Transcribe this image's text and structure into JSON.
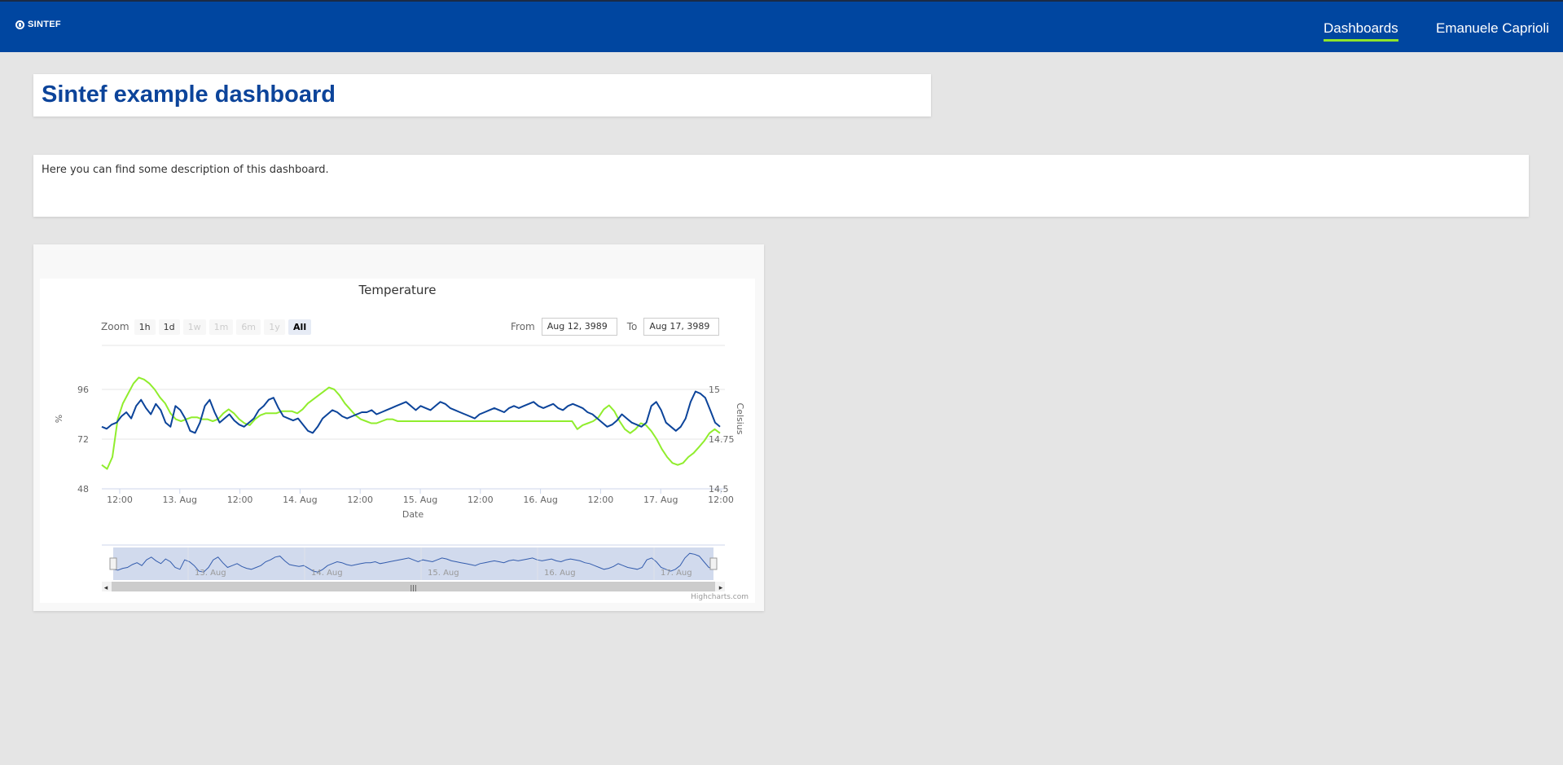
{
  "header": {
    "logo_text": "SINTEF",
    "nav_dashboards": "Dashboards",
    "nav_user": "Emanuele Caprioli"
  },
  "dashboard": {
    "title": "Sintef example dashboard",
    "description": "Here you can find some description of this dashboard."
  },
  "colors": {
    "accent": "#8ee32a",
    "brand": "#0046a0",
    "series_humidity": "#0c449a",
    "series_temperature": "#90ed2d"
  },
  "chart": {
    "zoom_label": "Zoom",
    "zoom_buttons": [
      {
        "label": "1h",
        "state": "normal"
      },
      {
        "label": "1d",
        "state": "normal"
      },
      {
        "label": "1w",
        "state": "disabled"
      },
      {
        "label": "1m",
        "state": "disabled"
      },
      {
        "label": "6m",
        "state": "disabled"
      },
      {
        "label": "1y",
        "state": "disabled"
      },
      {
        "label": "All",
        "state": "active"
      }
    ],
    "from_label": "From",
    "from_value": "Aug 12, 3989",
    "to_label": "To",
    "to_value": "Aug 17, 3989",
    "credits": "Highcharts.com"
  },
  "chart_data": {
    "type": "line",
    "title": "Temperature",
    "xlabel": "Date",
    "x_tick_labels": [
      "12:00",
      "13. Aug",
      "12:00",
      "14. Aug",
      "12:00",
      "15. Aug",
      "12:00",
      "16. Aug",
      "12:00",
      "17. Aug",
      "12:00"
    ],
    "navigator_labels": [
      "13. Aug",
      "14. Aug",
      "15. Aug",
      "16. Aug",
      "17. Aug"
    ],
    "xlim": [
      "3989-08-12 12:00",
      "3989-08-17 12:00"
    ],
    "y_axes": [
      {
        "label": "%",
        "ticks": [
          "48",
          "72",
          "96"
        ],
        "range": [
          48,
          96
        ],
        "side": "left"
      },
      {
        "label": "Celsius",
        "ticks": [
          "14.5",
          "14.75",
          "15"
        ],
        "range": [
          14.5,
          15
        ],
        "side": "right"
      }
    ],
    "grid": true,
    "series": [
      {
        "axis": 0,
        "values": [
          78,
          77,
          79,
          80,
          83,
          85,
          82,
          88,
          91,
          87,
          84,
          89,
          86,
          80,
          78,
          88,
          86,
          82,
          76,
          75,
          80,
          88,
          91,
          85,
          80,
          82,
          84,
          81,
          79,
          78,
          80,
          82,
          86,
          88,
          91,
          92,
          87,
          83,
          82,
          81,
          82,
          79,
          76,
          75,
          78,
          82,
          84,
          86,
          85,
          83,
          82,
          83,
          84,
          85,
          85,
          86,
          84,
          85,
          86,
          87,
          88,
          89,
          90,
          88,
          86,
          88,
          87,
          86,
          88,
          90,
          89,
          87,
          86,
          85,
          84,
          83,
          82,
          84,
          85,
          86,
          87,
          86,
          85,
          87,
          88,
          87,
          88,
          89,
          90,
          88,
          87,
          88,
          89,
          87,
          86,
          88,
          89,
          88,
          87,
          85,
          84,
          82,
          80,
          78,
          79,
          81,
          84,
          82,
          80,
          79,
          78,
          80,
          88,
          90,
          86,
          80,
          78,
          76,
          78,
          82,
          90,
          95,
          94,
          92,
          86,
          80,
          78
        ]
      },
      {
        "axis": 1,
        "values": [
          14.62,
          14.6,
          14.66,
          14.85,
          14.93,
          14.98,
          15.03,
          15.06,
          15.05,
          15.03,
          15.0,
          14.96,
          14.93,
          14.88,
          14.85,
          14.84,
          14.85,
          14.86,
          14.86,
          14.85,
          14.85,
          14.84,
          14.85,
          14.88,
          14.9,
          14.88,
          14.85,
          14.83,
          14.82,
          14.85,
          14.87,
          14.88,
          14.88,
          14.88,
          14.89,
          14.89,
          14.89,
          14.88,
          14.9,
          14.93,
          14.95,
          14.97,
          14.99,
          15.01,
          15.0,
          14.97,
          14.93,
          14.9,
          14.87,
          14.85,
          14.84,
          14.83,
          14.83,
          14.84,
          14.85,
          14.85,
          14.84,
          14.84,
          14.84,
          14.84,
          14.84,
          14.84,
          14.84,
          14.84,
          14.84,
          14.84,
          14.84,
          14.84,
          14.84,
          14.84,
          14.84,
          14.84,
          14.84,
          14.84,
          14.84,
          14.84,
          14.84,
          14.84,
          14.84,
          14.84,
          14.84,
          14.84,
          14.84,
          14.84,
          14.84,
          14.84,
          14.84,
          14.84,
          14.84,
          14.84,
          14.8,
          14.82,
          14.83,
          14.84,
          14.86,
          14.9,
          14.92,
          14.89,
          14.84,
          14.8,
          14.78,
          14.8,
          14.83,
          14.82,
          14.79,
          14.75,
          14.7,
          14.66,
          14.63,
          14.62,
          14.63,
          14.66,
          14.68,
          14.71,
          14.74,
          14.78,
          14.8,
          14.78
        ]
      }
    ]
  }
}
